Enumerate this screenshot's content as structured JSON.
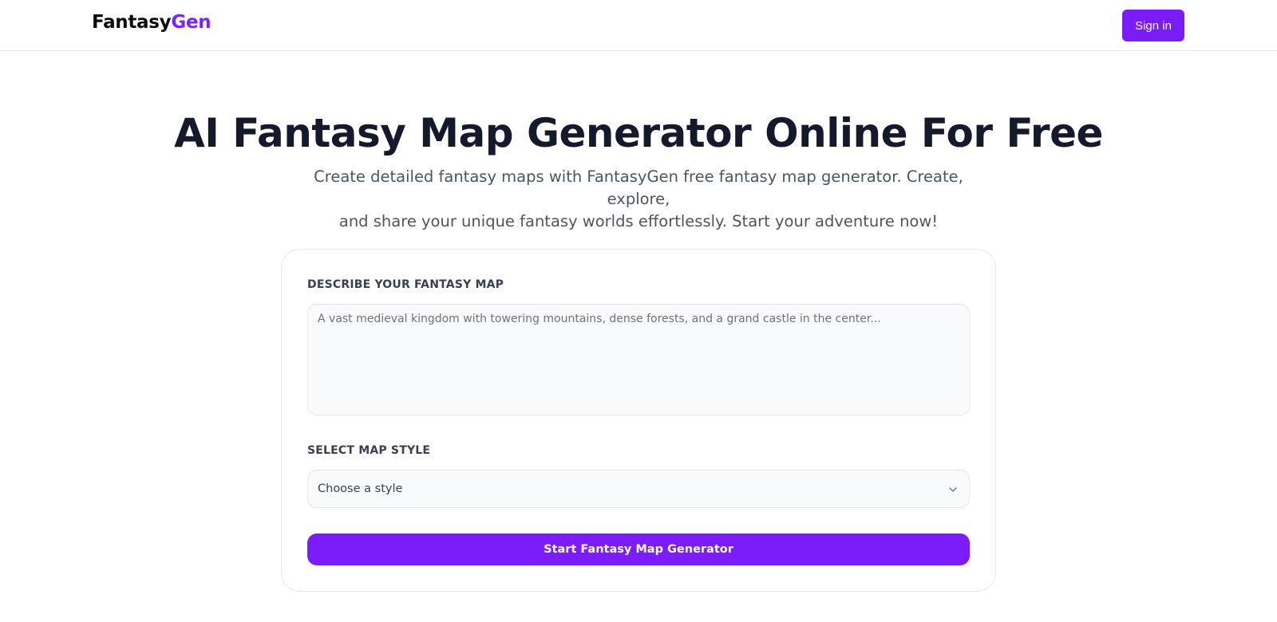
{
  "header": {
    "logo_main": "Fantasy",
    "logo_accent": "Gen",
    "signin_label": "Sign in"
  },
  "hero": {
    "title": "AI Fantasy Map Generator Online For Free",
    "subtitle_line1": "Create detailed fantasy maps with FantasyGen free fantasy map generator. Create, explore,",
    "subtitle_line2": "and share your unique fantasy worlds effortlessly. Start your adventure now!"
  },
  "form": {
    "describe_label": "DESCRIBE YOUR FANTASY MAP",
    "describe_placeholder": "A vast medieval kingdom with towering mountains, dense forests, and a grand castle in the center...",
    "describe_value": "",
    "style_label": "SELECT MAP STYLE",
    "style_selected": "Choose a style",
    "style_icon": "chevron-down-icon",
    "submit_label": "Start Fantasy Map Generator"
  },
  "colors": {
    "accent": "#7a1cf5",
    "logo_accent": "#7c22ff",
    "title": "#141a2b",
    "subtitle": "#4b5563",
    "field_bg": "#f9fafb",
    "border": "#e5e7eb"
  }
}
